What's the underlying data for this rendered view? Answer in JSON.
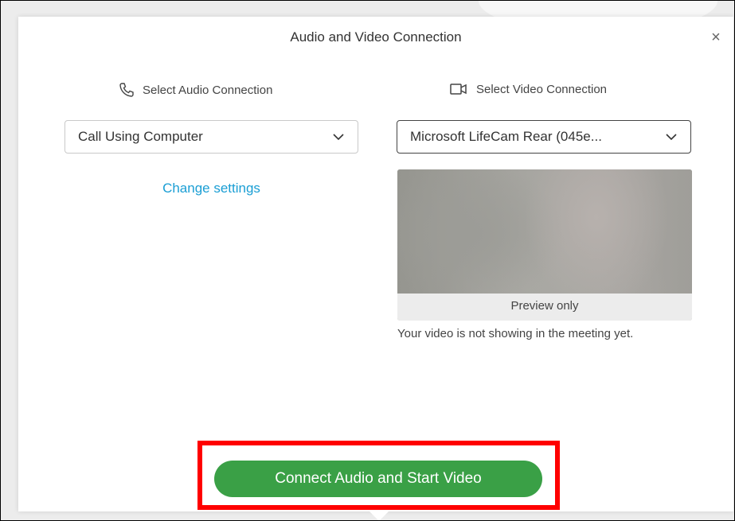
{
  "dialog": {
    "title": "Audio and Video Connection",
    "close_label": "×"
  },
  "audio": {
    "heading": "Select Audio Connection",
    "icon": "phone-icon",
    "selected": "Call Using Computer",
    "change_settings": "Change settings"
  },
  "video": {
    "heading": "Select Video Connection",
    "icon": "video-camera-icon",
    "selected": "Microsoft LifeCam Rear (045e...",
    "preview_label": "Preview only",
    "preview_note": "Your video is not showing in the meeting yet."
  },
  "actions": {
    "connect_label": "Connect Audio and Start Video"
  },
  "colors": {
    "accent_link": "#1a9ed4",
    "primary_button": "#3aa046",
    "highlight_border": "#ff0000"
  }
}
